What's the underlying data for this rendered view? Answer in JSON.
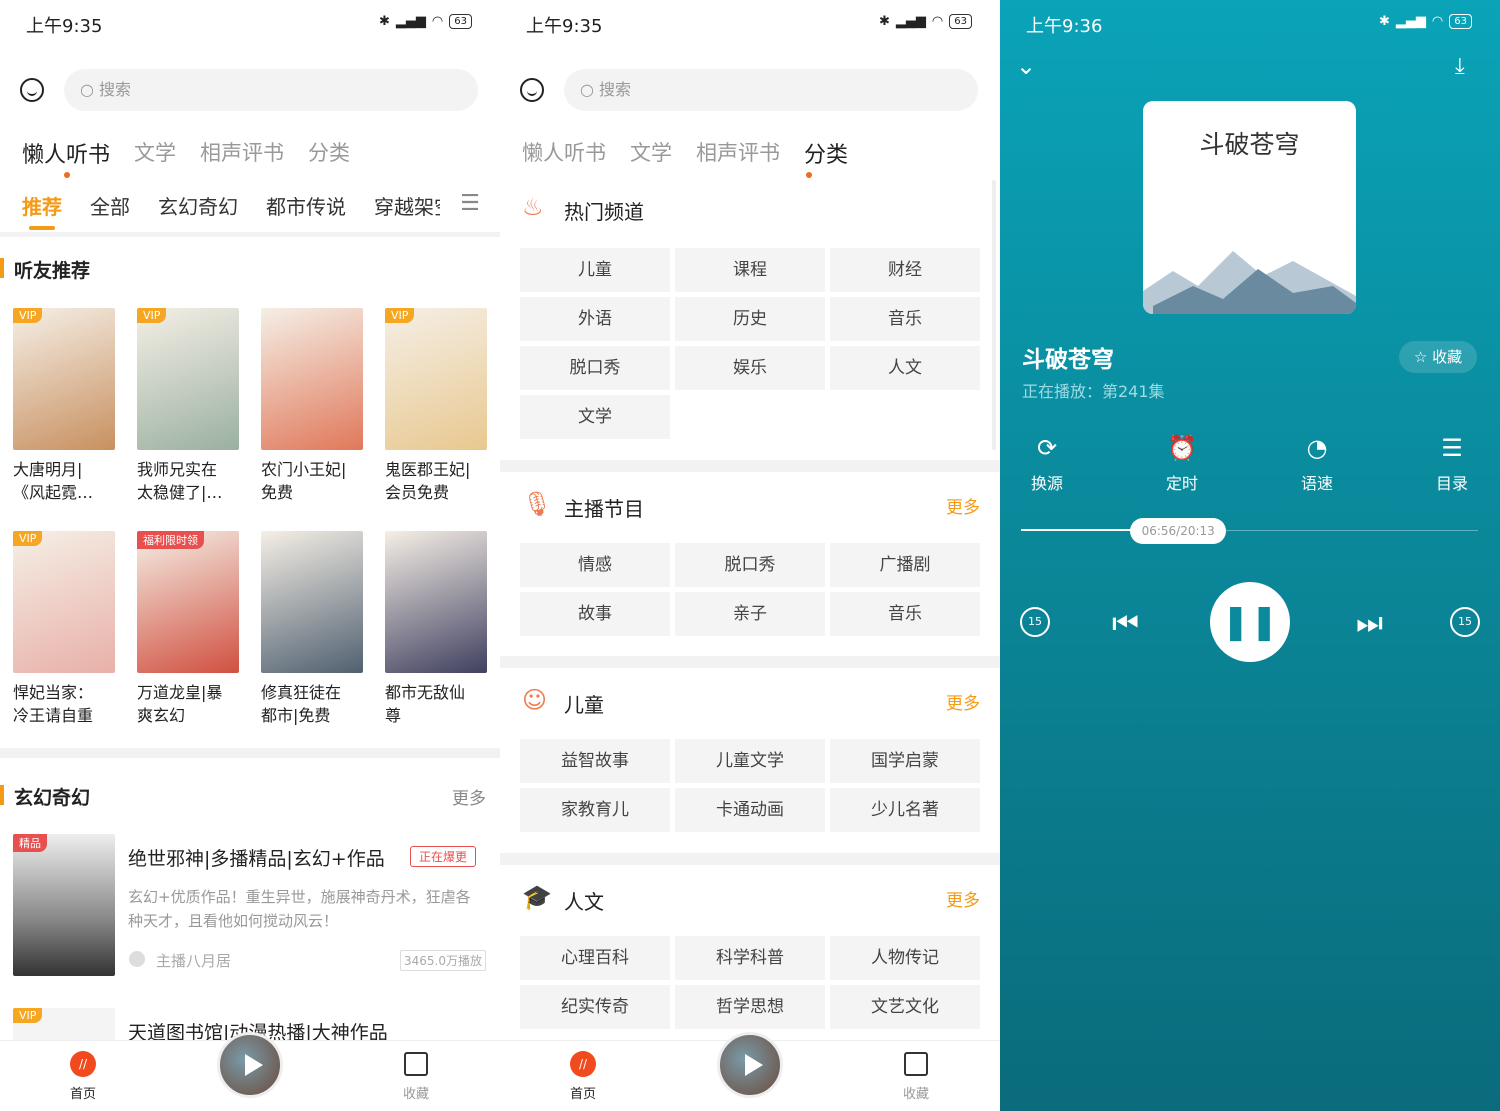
{
  "panel1": {
    "status": {
      "time": "上午9:35",
      "battery": "63"
    },
    "search_placeholder": "搜索",
    "tabs": [
      "懒人听书",
      "文学",
      "相声评书",
      "分类"
    ],
    "subtabs": [
      "推荐",
      "全部",
      "玄幻奇幻",
      "都市传说",
      "穿越架空"
    ],
    "section1": {
      "title": "听友推荐"
    },
    "books": [
      {
        "l1": "大唐明月|",
        "l2": "《风起霓…",
        "badge": "VIP",
        "color": "#c89060"
      },
      {
        "l1": "我师兄实在",
        "l2": "太稳健了|…",
        "badge": "VIP",
        "color": "#9ab0a0"
      },
      {
        "l1": "农门小王妃|",
        "l2": "免费",
        "badge": "",
        "color": "#e0785a"
      },
      {
        "l1": "鬼医郡王妃|",
        "l2": "会员免费",
        "badge": "VIP",
        "color": "#e8c890"
      },
      {
        "l1": "悍妃当家：",
        "l2": "冷王请自重",
        "badge": "VIP",
        "color": "#e8b0a8"
      },
      {
        "l1": "万道龙皇|暴",
        "l2": "爽玄幻",
        "badge": "福利限时领",
        "color": "#d05040"
      },
      {
        "l1": "修真狂徒在",
        "l2": "都市|免费",
        "badge": "",
        "color": "#506070"
      },
      {
        "l1": "都市无敌仙",
        "l2": "尊",
        "badge": "",
        "color": "#404060"
      }
    ],
    "section2": {
      "title": "玄幻奇幻",
      "more": "更多"
    },
    "list": [
      {
        "badge": "精品",
        "title": "绝世邪神|多播精品|玄幻+作品",
        "tag": "正在爆更",
        "desc": "玄幻+优质作品！重生异世，施展神奇丹术，狂虐各种天才，且看他如何搅动风云！",
        "anchor": "主播八月居",
        "plays": "3465.0万播放"
      },
      {
        "badge": "VIP",
        "title": "天道图书馆|动漫热播|大神作品"
      }
    ],
    "nav": {
      "home": "首页",
      "fav": "收藏"
    }
  },
  "panel2": {
    "status": {
      "time": "上午9:35",
      "battery": "63"
    },
    "search_placeholder": "搜索",
    "tabs": [
      "懒人听书",
      "文学",
      "相声评书",
      "分类"
    ],
    "sections": [
      {
        "title": "热门频道",
        "more": "",
        "icon": "flame-icon",
        "items": [
          "儿童",
          "课程",
          "财经",
          "外语",
          "历史",
          "音乐",
          "脱口秀",
          "娱乐",
          "人文",
          "文学"
        ]
      },
      {
        "title": "主播节目",
        "more": "更多",
        "icon": "microphone-icon",
        "items": [
          "情感",
          "脱口秀",
          "广播剧",
          "故事",
          "亲子",
          "音乐"
        ]
      },
      {
        "title": "儿童",
        "more": "更多",
        "icon": "baby-face-icon",
        "items": [
          "益智故事",
          "儿童文学",
          "国学启蒙",
          "家教育儿",
          "卡通动画",
          "少儿名著"
        ]
      },
      {
        "title": "人文",
        "more": "更多",
        "icon": "graduation-cap-icon",
        "items": [
          "心理百科",
          "科学科普",
          "人物传记",
          "纪实传奇",
          "哲学思想",
          "文艺文化"
        ]
      }
    ],
    "nav": {
      "home": "首页",
      "fav": "收藏"
    }
  },
  "panel3": {
    "status": {
      "time": "上午9:36",
      "battery": "63"
    },
    "album_title": "斗破苍穹",
    "title": "斗破苍穹",
    "subtitle": "正在播放：第241集",
    "fav": "收藏",
    "controls": [
      "换源",
      "定时",
      "语速",
      "目录"
    ],
    "time": "06:56/20:13",
    "progress": 0.344,
    "skip_seconds": "15",
    "colors": {
      "accent": "#f59a16",
      "player_bg": "#0a95a8"
    }
  }
}
